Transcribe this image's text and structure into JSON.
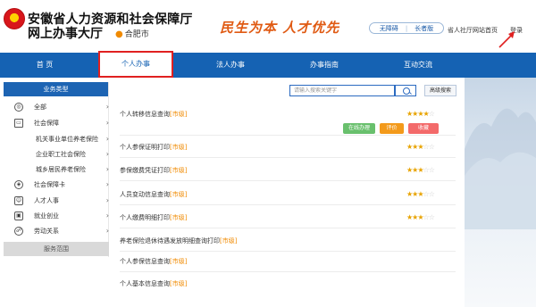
{
  "header": {
    "title_line1": "安徽省人力资源和社会保障厅",
    "title_line2": "网上办事大厅",
    "city": "合肥市",
    "slogan": "民生为本 人才优先",
    "accessibility": "无障碍",
    "elder_edition": "长者版",
    "site_home": "省人社厅网站首页",
    "login": "登录"
  },
  "nav": {
    "items": [
      "首 页",
      "个人办事",
      "法人办事",
      "办事指南",
      "互动交流"
    ]
  },
  "sidebar": {
    "title": "业务类型",
    "items": [
      {
        "label": "全部",
        "icon": "globe-icon"
      },
      {
        "label": "社会保障",
        "icon": "card-icon"
      },
      {
        "label": "机关事业单位养老保险",
        "icon": ""
      },
      {
        "label": "企业职工社会保险",
        "icon": ""
      },
      {
        "label": "城乡居民养老保险",
        "icon": ""
      },
      {
        "label": "社会保障卡",
        "icon": "shield-icon"
      },
      {
        "label": "人才人事",
        "icon": "person-icon"
      },
      {
        "label": "就业创业",
        "icon": "briefcase-icon"
      },
      {
        "label": "劳动关系",
        "icon": "people-icon"
      }
    ],
    "footer": "服务范围"
  },
  "search": {
    "placeholder": "请输入搜索关键字",
    "advanced": "高级搜索"
  },
  "services": [
    {
      "name": "个人转移信息查询",
      "tag": "[市级]",
      "rating": 4.5
    },
    {
      "name": "个人参保证明打印",
      "tag": "[市级]",
      "rating": 3.5
    },
    {
      "name": "参保缴费凭证打印",
      "tag": "[市级]",
      "rating": 3.5
    },
    {
      "name": "人员变动信息查询",
      "tag": "[市级]",
      "rating": 3.5
    },
    {
      "name": "个人缴费明细打印",
      "tag": "[市级]",
      "rating": 3.5
    },
    {
      "name": "养老保险退休待遇发放明细查询打印",
      "tag": "[市级]",
      "rating": 0
    },
    {
      "name": "个人参保信息查询",
      "tag": "[市级]",
      "rating": 0
    },
    {
      "name": "个人基本信息查询",
      "tag": "[市级]",
      "rating": 0
    }
  ],
  "actions": {
    "handle": "在线办理",
    "evaluate": "评价",
    "favorite": "收藏"
  },
  "colors": {
    "primary": "#1562b3",
    "accent": "#f08a00",
    "handle": "#69c06d",
    "evaluate": "#f39a1b",
    "favorite": "#f36a6a"
  }
}
